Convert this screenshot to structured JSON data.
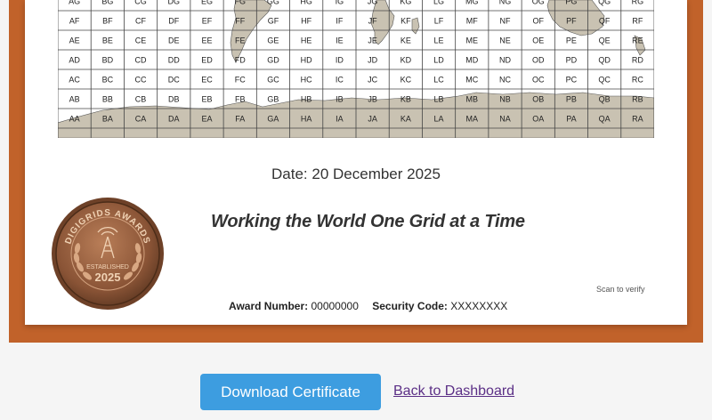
{
  "certificate": {
    "grid_rows": [
      [
        "AG",
        "BG",
        "CG",
        "DG",
        "EG",
        "FG",
        "GG",
        "HG",
        "IG",
        "JG",
        "KG",
        "LG",
        "MG",
        "NG",
        "OG",
        "PG",
        "QG",
        "RG"
      ],
      [
        "AF",
        "BF",
        "CF",
        "DF",
        "EF",
        "FF",
        "GF",
        "HF",
        "IF",
        "JF",
        "KF",
        "LF",
        "MF",
        "NF",
        "OF",
        "PF",
        "QF",
        "RF"
      ],
      [
        "AE",
        "BE",
        "CE",
        "DE",
        "EE",
        "FE",
        "GE",
        "HE",
        "IE",
        "JE",
        "KE",
        "LE",
        "ME",
        "NE",
        "OE",
        "PE",
        "QE",
        "RE"
      ],
      [
        "AD",
        "BD",
        "CD",
        "DD",
        "ED",
        "FD",
        "GD",
        "HD",
        "ID",
        "JD",
        "KD",
        "LD",
        "MD",
        "ND",
        "OD",
        "PD",
        "QD",
        "RD"
      ],
      [
        "AC",
        "BC",
        "CC",
        "DC",
        "EC",
        "FC",
        "GC",
        "HC",
        "IC",
        "JC",
        "KC",
        "LC",
        "MC",
        "NC",
        "OC",
        "PC",
        "QC",
        "RC"
      ],
      [
        "AB",
        "BB",
        "CB",
        "DB",
        "EB",
        "FB",
        "GB",
        "HB",
        "IB",
        "JB",
        "KB",
        "LB",
        "MB",
        "NB",
        "OB",
        "PB",
        "QB",
        "RB"
      ],
      [
        "AA",
        "BA",
        "CA",
        "DA",
        "EA",
        "FA",
        "GA",
        "HA",
        "IA",
        "JA",
        "KA",
        "LA",
        "MA",
        "NA",
        "OA",
        "PA",
        "QA",
        "RA"
      ]
    ],
    "date": "Date: 20 December 2025",
    "motto": "Working the World One Grid at a Time",
    "medal": {
      "ring_text": "DIGIGRIDS AWARDS",
      "established": "ESTABLISHED",
      "year": "2025"
    },
    "scan_label": "Scan to verify",
    "award_number_label": "Award Number:",
    "award_number": "00000000",
    "security_code_label": "Security Code:",
    "security_code": "XXXXXXXX"
  },
  "actions": {
    "download_label": "Download Certificate",
    "back_label": "Back to Dashboard"
  },
  "colors": {
    "frame": "#c1622a",
    "land": "#c9c2b2",
    "button": "#3d9de0",
    "link": "#5b2f86"
  }
}
